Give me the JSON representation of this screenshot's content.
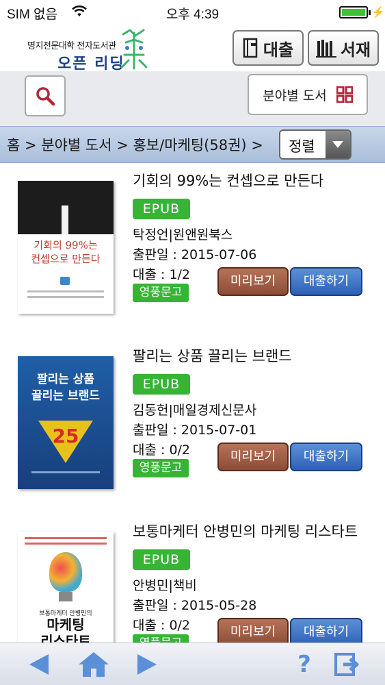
{
  "status": {
    "carrier": "SIM 없음",
    "time": "오후 4:39"
  },
  "header": {
    "logo_sub": "명지전문대학 전자도서관",
    "logo_main": "오픈 리딩",
    "loan_label": "대출",
    "shelf_label": "서재"
  },
  "toolbar": {
    "category_label": "분야별 도서"
  },
  "breadcrumb": {
    "text": "홈 > 분야별 도서 > 홍보/마케팅(58권) >",
    "sort_label": "정렬"
  },
  "colors": {
    "accent_green": "#36b534",
    "preview_brown": "#9a5a42",
    "borrow_blue": "#3a6fc4",
    "crumb_bg": "#b9cbe3"
  },
  "books": [
    {
      "title": "기회의 99%는 컨셉으로 만든다",
      "format": "EPUB",
      "author": "탁정언|원앤원북스",
      "pub_date": "출판일 : 2015-07-06",
      "loan": "대출 : 1/2",
      "branch": "영풍문고",
      "preview_label": "미리보기",
      "borrow_label": "대출하기",
      "cover": {
        "line1": "기회의 99%는",
        "line2": "컨셉으로 만든다"
      }
    },
    {
      "title": "팔리는 상품 끌리는 브랜드",
      "format": "EPUB",
      "author": "김동헌|매일경제신문사",
      "pub_date": "출판일 : 2015-07-01",
      "loan": "대출 : 0/2",
      "branch": "영풍문고",
      "preview_label": "미리보기",
      "borrow_label": "대출하기",
      "cover": {
        "line1": "팔리는 상품",
        "line2": "끌리는 브랜드",
        "number": "25"
      }
    },
    {
      "title": "보통마케터 안병민의 마케팅 리스타트",
      "format": "EPUB",
      "author": "안병민|책비",
      "pub_date": "출판일 : 2015-05-28",
      "loan": "대출 : 0/2",
      "branch": "영풍문고",
      "preview_label": "미리보기",
      "borrow_label": "대출하기",
      "cover": {
        "line1": "마케팅",
        "line2": "리스타트",
        "small": "보통마케터 안병민의"
      }
    }
  ],
  "icons": [
    "wifi-icon",
    "battery-icon",
    "search-icon",
    "grid-icon",
    "book-icon",
    "bookshelf-icon",
    "chevron-down-icon",
    "back-arrow-icon",
    "home-icon",
    "forward-arrow-icon",
    "help-icon",
    "exit-icon"
  ]
}
